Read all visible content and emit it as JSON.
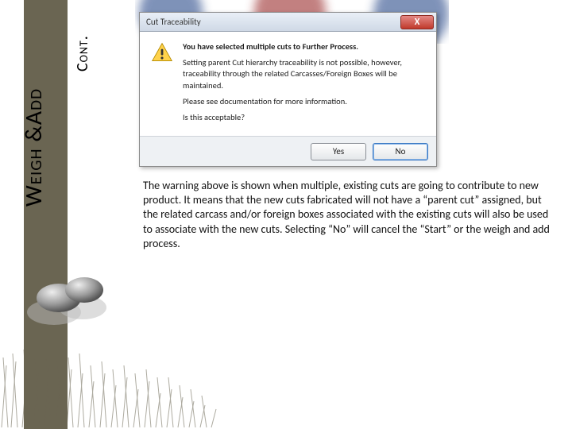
{
  "sidebar": {
    "title_main": "Weigh &Add",
    "title_cont": "Cont."
  },
  "dialog": {
    "title": "Cut Traceability",
    "close_label": "X",
    "line1": "You have selected multiple cuts to Further Process.",
    "line2": "Setting parent Cut hierarchy traceability is not possible, however, traceability through the related Carcasses/Foreign Boxes will be maintained.",
    "line3": "Please see documentation for more information.",
    "line4": "Is this acceptable?",
    "yes": "Yes",
    "no": "No"
  },
  "explanation": "The warning above is shown when multiple, existing cuts are going to contribute to new product. It means that the new cuts fabricated will not have a “parent cut” assigned, but the related carcass and/or foreign boxes associated with the existing cuts will also be used to associate with the new cuts. Selecting “No” will cancel the “Start” or the weigh and add process."
}
